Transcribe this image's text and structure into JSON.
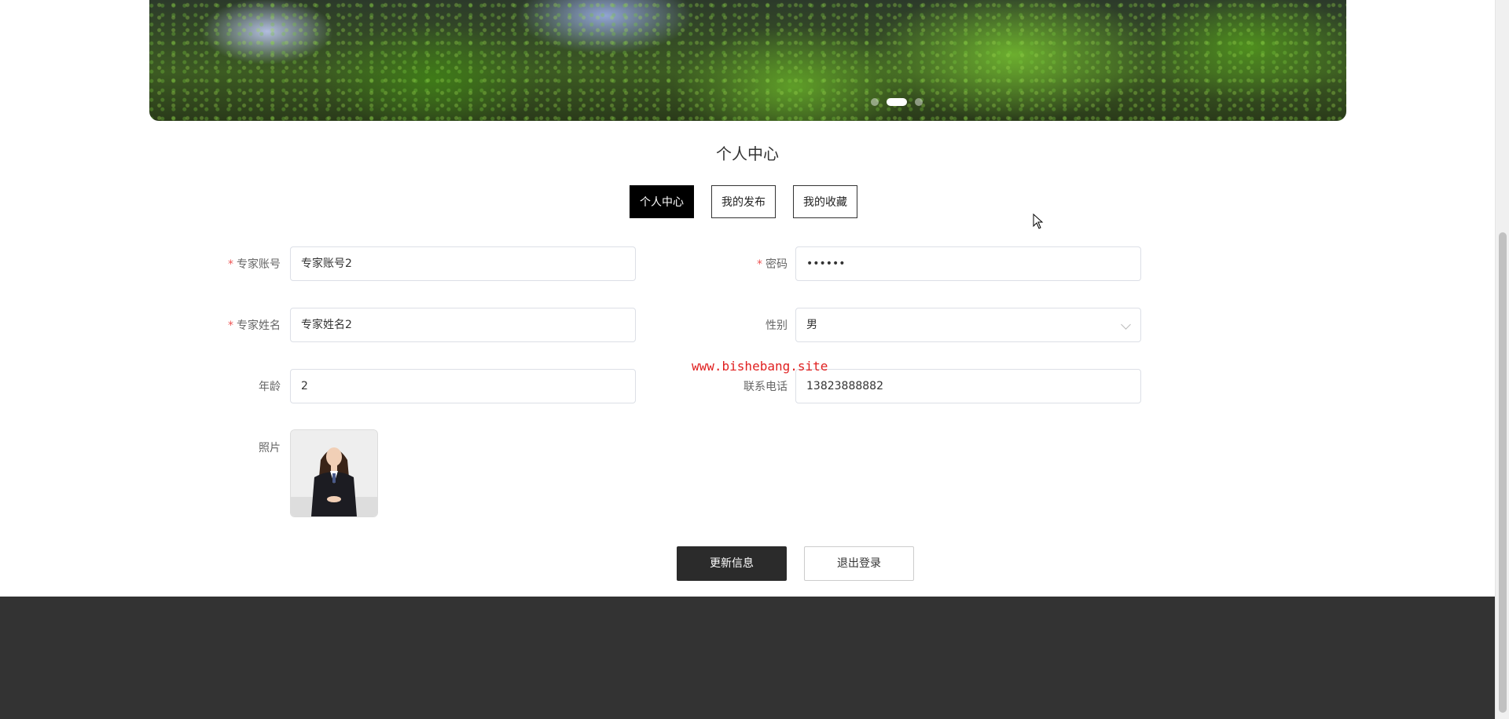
{
  "carousel": {
    "slide_count": 3,
    "active_index": 1
  },
  "section": {
    "title": "个人中心"
  },
  "tabs": [
    {
      "label": "个人中心",
      "active": true
    },
    {
      "label": "我的发布",
      "active": false
    },
    {
      "label": "我的收藏",
      "active": false
    }
  ],
  "form": {
    "account": {
      "label": "专家账号",
      "required": "*",
      "value": "专家账号2"
    },
    "password": {
      "label": "密码",
      "required": "*",
      "value": "••••••"
    },
    "name": {
      "label": "专家姓名",
      "required": "*",
      "value": "专家姓名2"
    },
    "gender": {
      "label": "性别",
      "value": "男"
    },
    "age": {
      "label": "年龄",
      "value": "2"
    },
    "phone": {
      "label": "联系电话",
      "value": "13823888882"
    },
    "photo": {
      "label": "照片"
    }
  },
  "watermark": "www.bishebang.site",
  "actions": {
    "update": "更新信息",
    "logout": "退出登录"
  },
  "colors": {
    "primary_button": "#2b2b2b",
    "footer": "#333333",
    "required": "#e55555",
    "watermark": "#e02020"
  }
}
